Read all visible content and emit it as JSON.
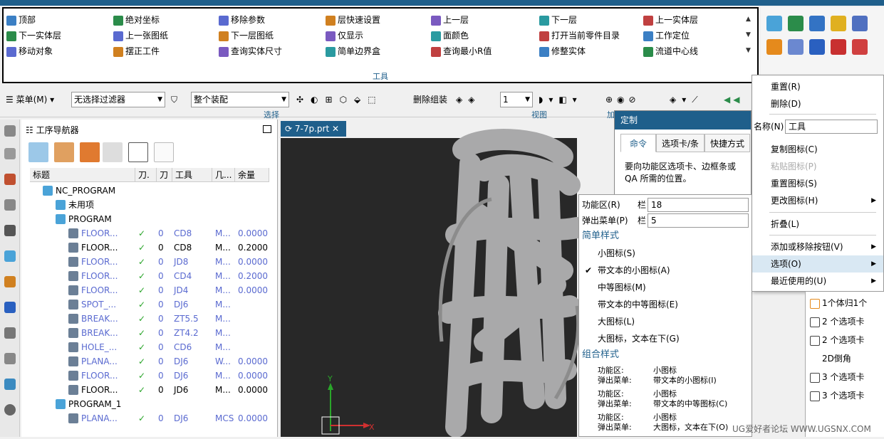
{
  "ribbon": {
    "group_label": "工具",
    "items": [
      [
        "顶部",
        "绝对坐标",
        "移除参数",
        "层快速设置",
        "上一层",
        "下一层",
        "上一实体层"
      ],
      [
        "下一实体层",
        "上一张图纸",
        "下一层图纸",
        "仅显示",
        "面颜色",
        "打开当前零件目录",
        "工作定位"
      ],
      [
        "移动对象",
        "摆正工件",
        "查询实体尺寸",
        "简单边界盒",
        "查询最小R值",
        "修整实体",
        "流道中心线"
      ]
    ]
  },
  "toolbar": {
    "menu_label": "菜单(M)",
    "filter_value": "无选择过滤器",
    "assembly_value": "整个装配",
    "delete_group": "删除组装",
    "number_value": "1",
    "select_group": "选择",
    "view_group": "视图",
    "plus_group": "加"
  },
  "navigator": {
    "title": "工序导航器",
    "columns": [
      "标题",
      "刀.",
      "刀",
      "工具",
      "几...",
      "余量"
    ],
    "rows": [
      {
        "indent": 0,
        "name": "NC_PROGRAM",
        "blue": false,
        "type": "root"
      },
      {
        "indent": 1,
        "name": "未用项",
        "blue": false,
        "type": "folder"
      },
      {
        "indent": 1,
        "name": "PROGRAM",
        "blue": false,
        "type": "program"
      },
      {
        "indent": 2,
        "name": "FLOOR...",
        "blue": true,
        "n": "0",
        "tool": "CD8",
        "geo": "M...",
        "stock": "0.0000"
      },
      {
        "indent": 2,
        "name": "FLOOR...",
        "blue": false,
        "n": "0",
        "tool": "CD8",
        "geo": "M...",
        "stock": "0.2000"
      },
      {
        "indent": 2,
        "name": "FLOOR...",
        "blue": true,
        "n": "0",
        "tool": "JD8",
        "geo": "M...",
        "stock": "0.0000"
      },
      {
        "indent": 2,
        "name": "FLOOR...",
        "blue": true,
        "n": "0",
        "tool": "CD4",
        "geo": "M...",
        "stock": "0.2000"
      },
      {
        "indent": 2,
        "name": "FLOOR...",
        "blue": true,
        "n": "0",
        "tool": "JD4",
        "geo": "M...",
        "stock": "0.0000"
      },
      {
        "indent": 2,
        "name": "SPOT_...",
        "blue": true,
        "n": "0",
        "tool": "DJ6",
        "geo": "M...",
        "stock": ""
      },
      {
        "indent": 2,
        "name": "BREAK...",
        "blue": true,
        "n": "0",
        "tool": "ZT5.5",
        "geo": "M...",
        "stock": ""
      },
      {
        "indent": 2,
        "name": "BREAK...",
        "blue": true,
        "n": "0",
        "tool": "ZT4.2",
        "geo": "M...",
        "stock": ""
      },
      {
        "indent": 2,
        "name": "HOLE_...",
        "blue": true,
        "n": "0",
        "tool": "CD6",
        "geo": "M...",
        "stock": ""
      },
      {
        "indent": 2,
        "name": "PLANA...",
        "blue": true,
        "n": "0",
        "tool": "DJ6",
        "geo": "W...",
        "stock": "0.0000"
      },
      {
        "indent": 2,
        "name": "FLOOR...",
        "blue": true,
        "n": "0",
        "tool": "DJ6",
        "geo": "M...",
        "stock": "0.0000"
      },
      {
        "indent": 2,
        "name": "FLOOR...",
        "blue": false,
        "n": "0",
        "tool": "JD6",
        "geo": "M...",
        "stock": "0.0000"
      },
      {
        "indent": 1,
        "name": "PROGRAM_1",
        "blue": false,
        "type": "program"
      },
      {
        "indent": 2,
        "name": "PLANA...",
        "blue": true,
        "n": "0",
        "tool": "DJ6",
        "geo": "MCS",
        "stock": "0.0000"
      }
    ]
  },
  "file_tab": "7-7p.prt",
  "customize": {
    "title": "定制",
    "tabs": [
      "命令",
      "选项卡/条",
      "快捷方式"
    ],
    "desc": "要向功能区选项卡、边框条或 QA 所需的位置。"
  },
  "options_panel": {
    "ribbon_label": "功能区(R)",
    "ribbon_col": "栏",
    "ribbon_value": "18",
    "popup_label": "弹出菜单(P)",
    "popup_col": "栏",
    "popup_value": "5",
    "simple_header": "简单样式",
    "simple": [
      "小图标(S)",
      "带文本的小图标(A)",
      "中等图标(M)",
      "带文本的中等图标(E)",
      "大图标(L)",
      "大图标，文本在下(G)"
    ],
    "checked_index": 1,
    "combo_header": "组合样式",
    "combos": [
      {
        "a": "功能区:",
        "b": "小图标",
        "c": "弹出菜单:",
        "d": "带文本的小图标(I)"
      },
      {
        "a": "功能区:",
        "b": "小图标",
        "c": "弹出菜单:",
        "d": "带文本的中等图标(C)"
      },
      {
        "a": "功能区:",
        "b": "小图标",
        "c": "弹出菜单:",
        "d": "大图标，文本在下(O)"
      }
    ]
  },
  "context_menu": {
    "reset": "重置(R)",
    "delete": "删除(D)",
    "name_label": "名称(N)",
    "name_value": "工具",
    "copy_icon": "复制图标(C)",
    "paste_icon": "粘贴图标(P)",
    "reset_icon": "重置图标(S)",
    "change_icon": "更改图标(H)",
    "collapse": "折叠(L)",
    "add_remove": "添加或移除按钮(V)",
    "options": "选项(O)",
    "recent": "最近使用的(U)"
  },
  "right_panel": [
    "1个体归1个",
    "2 个选项卡",
    "2 个选项卡",
    "2D倒角",
    "3 个选项卡",
    "3 个选项卡"
  ],
  "watermark": "UG爱好者论坛 WWW.UGSNX.COM",
  "colors": {
    "accent": "#1f5f8b",
    "canvas": "#282828",
    "blue_text": "#5a6ad0",
    "check": "#2aa52a"
  }
}
